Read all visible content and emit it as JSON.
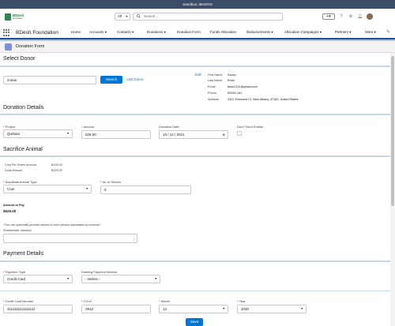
{
  "sandbox": "Sandbox: dev2019",
  "header": {
    "logo_text": "BDesh",
    "logo_sub": "Foundation",
    "scope": "All",
    "search_placeholder": "Search..."
  },
  "nav": {
    "app_name": "BDesh Foundation",
    "items": [
      "Home",
      "Accounts",
      "Contacts",
      "Donations",
      "Donation Form",
      "Funds Allocation",
      "Disbursements",
      "Allocation Campaigns",
      "Partners",
      "More"
    ],
    "active": "Donation Form"
  },
  "card_title": "Donation Form",
  "select_donor": {
    "title": "Select Donor",
    "search_value": "zonan",
    "search_button": "Search",
    "add_donor": "Add Donor",
    "edit": "Edit",
    "fields": [
      {
        "label": "First Name",
        "value": "Zonan"
      },
      {
        "label": "Last Name",
        "value": "Khan"
      },
      {
        "label": "Email",
        "value": "testu2141@gmail.com"
      },
      {
        "label": "Phone",
        "value": "50290-161"
      },
      {
        "label": "Address",
        "value": "2321 Elmwood Ct, New Albany, 47150, United States"
      }
    ]
  },
  "donation_details": {
    "title": "Donation Details",
    "project_label": "Project",
    "project_value": "Qurbani",
    "amount_label": "Amount",
    "amount_value": "625.00",
    "date_label": "Donation Date",
    "date_value": "10 / 12 / 2021",
    "dont_send_label": "Don't Send Emails"
  },
  "sacrifice": {
    "title": "Sacrifice Animal",
    "cost_label": "Cost Per Share Amount",
    "cost_value": "$125.00",
    "goat_label": "Goat Amount",
    "goat_value": "$125.00",
    "type_label": "Sacrificial Animal Type",
    "type_value": "Cow",
    "shares_label": "No of Shares",
    "shares_value": "5",
    "amount_to_pay_label": "Amount to Pay",
    "amount_to_pay_value": "$625.00",
    "names_hint": "*You can optionally provide names of each person separated by comma:*",
    "names_label": "Shareholder name(s)"
  },
  "payment": {
    "title": "Payment Details",
    "type_label": "Payment Type",
    "type_value": "Credit Card",
    "existing_label": "Existing Payment Method",
    "existing_value": "--Select--",
    "card_label": "Credit Card Number",
    "card_value": "4111111111111111",
    "cvv_label": "CVV2",
    "cvv_value": "2912",
    "month_label": "Month",
    "month_value": "12",
    "year_label": "Year",
    "year_value": "2030",
    "save": "Save"
  },
  "colors": {
    "brand": "#0176d3",
    "nav_active": "#1b5297",
    "logo": "#2e844a"
  }
}
